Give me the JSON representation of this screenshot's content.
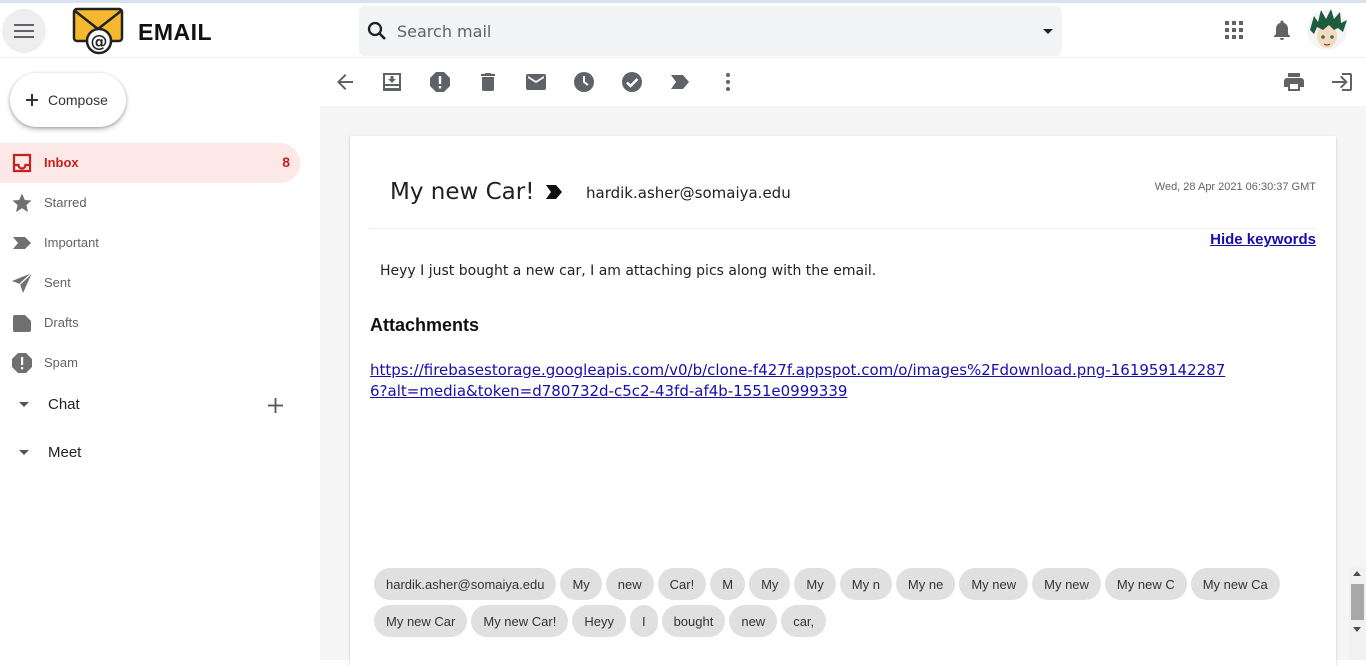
{
  "app": {
    "brand": "EMAIL"
  },
  "search": {
    "placeholder": "Search mail"
  },
  "compose": {
    "label": "Compose"
  },
  "sidebar": {
    "items": [
      {
        "label": "Inbox",
        "icon": "inbox-icon",
        "count": "8",
        "active": true
      },
      {
        "label": "Starred",
        "icon": "star-icon"
      },
      {
        "label": "Important",
        "icon": "label-important-icon"
      },
      {
        "label": "Sent",
        "icon": "send-icon"
      },
      {
        "label": "Drafts",
        "icon": "drafts-icon"
      },
      {
        "label": "Spam",
        "icon": "spam-icon"
      }
    ],
    "sections": [
      {
        "label": "Chat"
      },
      {
        "label": "Meet"
      }
    ]
  },
  "toolbar": {
    "icons": [
      "back-arrow-icon",
      "archive-icon",
      "report-spam-icon",
      "delete-icon",
      "mark-unread-icon",
      "snooze-icon",
      "mark-done-icon",
      "label-icon",
      "more-vert-icon",
      "print-icon",
      "open-in-new-icon"
    ]
  },
  "email": {
    "subject": "My new Car!",
    "sender": "hardik.asher@somaiya.edu",
    "date": "Wed, 28 Apr 2021 06:30:37 GMT",
    "hide_keywords": "Hide keywords",
    "body": "Heyy I just bought a new car, I am attaching pics along with the email.",
    "attachments_title": "Attachments",
    "attachment_link": "https://firebasestorage.googleapis.com/v0/b/clone-f427f.appspot.com/o/images%2Fdownload.png-1619591422876?alt=media&token=d780732d-c5c2-43fd-af4b-1551e0999339",
    "keywords": [
      "hardik.asher@somaiya.edu",
      "My",
      "new",
      "Car!",
      "M",
      "My",
      "My",
      "My n",
      "My ne",
      "My new",
      "My new",
      "My new C",
      "My new Ca",
      "My new Car",
      "My new Car!",
      "Heyy",
      "I",
      "bought",
      "new",
      "car,"
    ]
  },
  "colors": {
    "accent": "#c5221f",
    "active_bg": "#fce8e6",
    "link": "#1a0dab",
    "chip_bg": "#e0e0e0"
  }
}
